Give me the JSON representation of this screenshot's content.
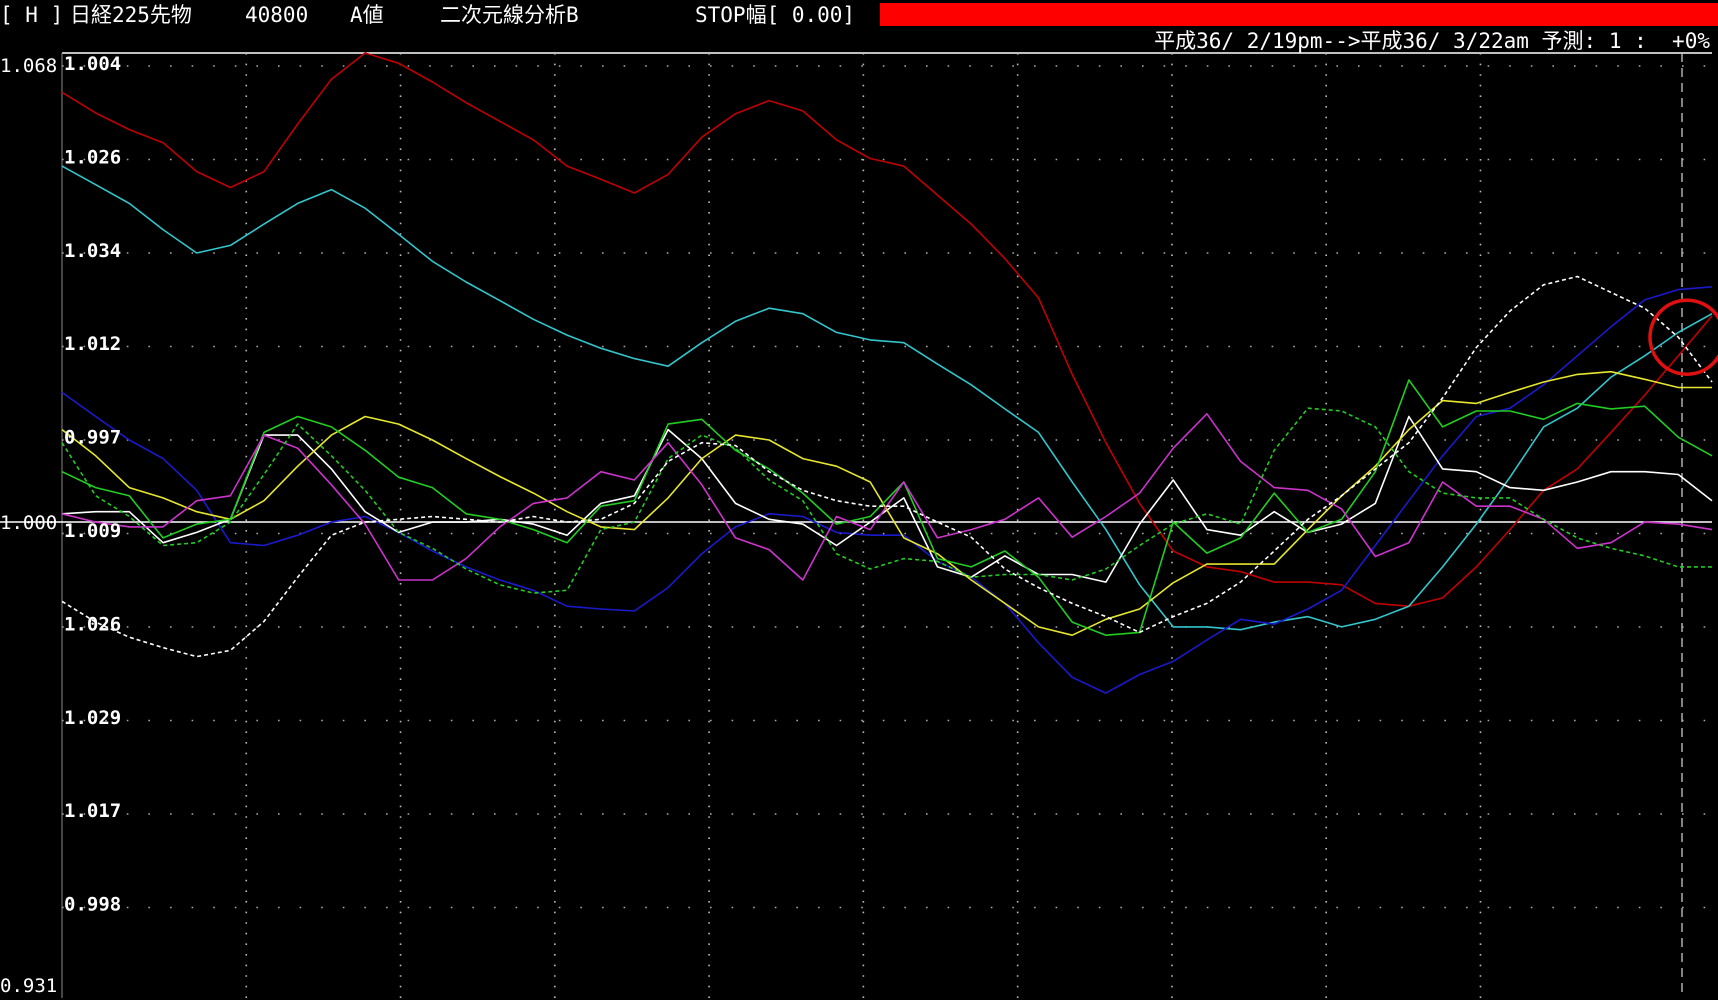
{
  "header": {
    "tag": "[ H ]",
    "instrument": "日経225先物",
    "code": "40800",
    "value_type": "A値",
    "analysis": "二次元線分析B",
    "stop": "STOP幅[ 0.00]",
    "range": "平成36/ 2/19pm-->平成36/ 3/22am 予測: 1 :  +0%"
  },
  "colors": {
    "background": "#000000",
    "red": "#c00000",
    "cyan": "#33c5cc",
    "blue": "#1a1acc",
    "white": "#ffffff",
    "yellow": "#e6e62e",
    "green": "#22cc22",
    "magenta": "#cc33cc",
    "green_dashed": "#22cc22",
    "white_dashed": "#ffffff",
    "highlight_circle": "#e01010"
  },
  "chart_data": {
    "type": "line",
    "title": "",
    "xlabel": "",
    "ylabel": "",
    "grid": true,
    "ylim": [
      0.931,
      1.068
    ],
    "left_axis": {
      "top": "1.068",
      "middle": "1.000",
      "bottom": "0.931"
    },
    "inner_ticks": [
      "1.004",
      "1.026",
      "1.034",
      "1.012",
      "0.997",
      "1.009",
      "1.026",
      "1.029",
      "1.017",
      "0.998"
    ],
    "x": [
      0,
      1,
      2,
      3,
      4,
      5,
      6,
      7,
      8,
      9,
      10,
      11,
      12,
      13,
      14,
      15,
      16,
      17,
      18,
      19,
      20,
      21,
      22,
      23,
      24,
      25,
      26,
      27,
      28,
      29,
      30,
      31,
      32,
      33,
      34,
      35,
      36,
      37,
      38,
      39,
      40,
      41,
      42,
      43,
      44,
      45,
      46,
      47,
      48,
      49
    ],
    "series": [
      {
        "color_key": "red",
        "dashed": false,
        "values": [
          1.0623,
          1.0593,
          1.0569,
          1.055,
          1.0508,
          1.0485,
          1.0508,
          1.0577,
          1.0642,
          1.068,
          1.0665,
          1.0638,
          1.0608,
          1.0581,
          1.0554,
          1.0516,
          1.0497,
          1.0477,
          1.0504,
          1.0558,
          1.0592,
          1.0611,
          1.0596,
          1.0554,
          1.0527,
          1.0516,
          1.0474,
          1.0432,
          1.0382,
          1.0325,
          1.0214,
          1.0115,
          1.0027,
          0.9958,
          0.9935,
          0.9928,
          0.9913,
          0.9913,
          0.9909,
          0.9882,
          0.9878,
          0.989,
          0.9935,
          0.9989,
          1.0046,
          1.0077,
          1.013,
          1.0184,
          1.0241,
          1.0299
        ]
      },
      {
        "color_key": "cyan",
        "dashed": false,
        "values": [
          1.0516,
          1.0489,
          1.0462,
          1.0424,
          1.039,
          1.0401,
          1.0432,
          1.0462,
          1.0482,
          1.0455,
          1.0417,
          1.0378,
          1.0348,
          1.0321,
          1.0294,
          1.0271,
          1.0252,
          1.0237,
          1.0226,
          1.026,
          1.0291,
          1.031,
          1.0302,
          1.0275,
          1.0264,
          1.026,
          1.0229,
          1.0199,
          1.0164,
          1.013,
          1.0058,
          0.9989,
          0.9909,
          0.9848,
          0.9848,
          0.9844,
          0.9855,
          0.9863,
          0.9848,
          0.9859,
          0.9878,
          0.9935,
          0.9997,
          1.0065,
          1.0138,
          1.0165,
          1.021,
          1.0241,
          1.0275,
          1.0302
        ]
      },
      {
        "color_key": "blue",
        "dashed": false,
        "values": [
          1.0188,
          1.0153,
          1.0119,
          1.0092,
          1.0046,
          0.997,
          0.9966,
          0.9981,
          1.0,
          1.0008,
          0.9985,
          0.9958,
          0.9935,
          0.9916,
          0.9901,
          0.9878,
          0.9874,
          0.9871,
          0.9905,
          0.9954,
          0.9993,
          1.0012,
          1.0008,
          0.9985,
          0.9981,
          0.9981,
          0.9943,
          0.992,
          0.9882,
          0.9825,
          0.9775,
          0.9752,
          0.9779,
          0.9798,
          0.9829,
          0.9859,
          0.9852,
          0.9874,
          0.9901,
          0.9966,
          1.0031,
          1.0096,
          1.0153,
          1.0165,
          1.0199,
          1.0241,
          1.0283,
          1.0322,
          1.0337,
          1.0341
        ]
      },
      {
        "color_key": "white",
        "dashed": false,
        "values": [
          1.0012,
          1.0015,
          1.0015,
          0.997,
          0.9985,
          1.0004,
          1.0126,
          1.0126,
          1.0077,
          1.0015,
          0.9985,
          1.0,
          1.0,
          1.0004,
          0.9997,
          0.9981,
          1.0027,
          1.0038,
          1.0134,
          1.0092,
          1.0027,
          1.0004,
          0.9997,
          0.9966,
          1.0,
          1.0035,
          0.9935,
          0.992,
          0.9951,
          0.9924,
          0.9924,
          0.9913,
          0.9997,
          1.0061,
          0.9989,
          0.9981,
          1.0015,
          0.9985,
          0.9997,
          1.0027,
          1.0153,
          1.0077,
          1.0073,
          1.005,
          1.0046,
          1.0058,
          1.0073,
          1.0073,
          1.0069,
          1.0031
        ]
      },
      {
        "color_key": "yellow",
        "dashed": false,
        "values": [
          1.0134,
          1.0096,
          1.005,
          1.0035,
          1.0015,
          1.0004,
          1.0031,
          1.0081,
          1.0126,
          1.0153,
          1.0142,
          1.0119,
          1.0092,
          1.0066,
          1.0042,
          1.0015,
          0.9993,
          0.9989,
          1.0035,
          1.0092,
          1.0126,
          1.0119,
          1.0092,
          1.0081,
          1.0058,
          0.9977,
          0.9954,
          0.9916,
          0.9882,
          0.9848,
          0.9836,
          0.9859,
          0.9874,
          0.9912,
          0.9939,
          0.9939,
          0.9939,
          0.9989,
          1.0038,
          1.0081,
          1.0134,
          1.0176,
          1.0172,
          1.0188,
          1.0203,
          1.0214,
          1.0218,
          1.0207,
          1.0195,
          1.0195
        ]
      },
      {
        "color_key": "green",
        "dashed": false,
        "values": [
          1.0073,
          1.005,
          1.0038,
          0.9977,
          0.9997,
          1.0004,
          1.013,
          1.0153,
          1.0138,
          1.0104,
          1.0065,
          1.005,
          1.0012,
          1.0004,
          0.9989,
          0.997,
          1.0023,
          1.0031,
          1.0142,
          1.0149,
          1.0104,
          1.0077,
          1.0042,
          0.9997,
          1.0008,
          1.0058,
          0.9947,
          0.9935,
          0.9958,
          0.992,
          0.9855,
          0.9836,
          0.984,
          1.0,
          0.9955,
          0.9977,
          1.0042,
          0.9985,
          1.0004,
          1.0073,
          1.0206,
          1.0138,
          1.0161,
          1.0161,
          1.0149,
          1.0172,
          1.0164,
          1.0168,
          1.0123,
          1.0096
        ]
      },
      {
        "color_key": "magenta",
        "dashed": false,
        "values": [
          1.0012,
          1.0,
          0.9993,
          0.9993,
          1.0031,
          1.0038,
          1.0126,
          1.0107,
          1.0054,
          0.9997,
          0.9916,
          0.9916,
          0.9947,
          0.9993,
          1.0027,
          1.0035,
          1.0073,
          1.0061,
          1.0115,
          1.0054,
          0.9977,
          0.996,
          0.9916,
          1.0008,
          0.9989,
          1.0058,
          0.9977,
          0.9989,
          1.0004,
          1.0035,
          0.9978,
          1.0008,
          1.0042,
          1.0107,
          1.0157,
          1.0088,
          1.005,
          1.0046,
          1.0019,
          0.995,
          0.997,
          1.0058,
          1.0023,
          1.0023,
          1.0004,
          0.9962,
          0.997,
          1.0,
          0.9997,
          0.9989
        ]
      },
      {
        "color_key": "green_dashed",
        "dashed": true,
        "values": [
          1.0115,
          1.0038,
          1.0008,
          0.9966,
          0.997,
          1.0,
          1.0069,
          1.0142,
          1.0096,
          1.0046,
          0.9985,
          0.9962,
          0.9932,
          0.9909,
          0.9897,
          0.9901,
          0.9989,
          1.0,
          1.0092,
          1.0126,
          1.0107,
          1.0061,
          1.0031,
          0.9954,
          0.9932,
          0.9947,
          0.9943,
          0.992,
          0.9924,
          0.9924,
          0.9916,
          0.9932,
          0.9966,
          0.9997,
          1.0012,
          0.9997,
          1.0104,
          1.0165,
          1.0161,
          1.0138,
          1.0073,
          1.0042,
          1.0035,
          1.0035,
          1.0004,
          0.9977,
          0.9962,
          0.9951,
          0.9935,
          0.9935
        ]
      },
      {
        "color_key": "white_dashed",
        "dashed": true,
        "values": [
          0.9885,
          0.9855,
          0.9833,
          0.9818,
          0.9805,
          0.9814,
          0.9856,
          0.992,
          0.9981,
          1.0,
          1.0004,
          1.0008,
          1.0004,
          1.0,
          1.0008,
          1.0,
          1.0004,
          1.0027,
          1.0088,
          1.0115,
          1.0111,
          1.0073,
          1.0046,
          1.0031,
          1.0023,
          1.0023,
          1.0,
          0.9978,
          0.9932,
          0.9905,
          0.9882,
          0.9863,
          0.984,
          0.9863,
          0.9882,
          0.9913,
          0.9958,
          1.0004,
          1.0038,
          1.0077,
          1.0115,
          1.018,
          1.0253,
          1.0306,
          1.0344,
          1.0356,
          1.0333,
          1.031,
          1.0268,
          1.0203
        ]
      }
    ],
    "annotations": [
      {
        "type": "circle",
        "index": 49,
        "value": 1.0268,
        "color_key": "highlight_circle"
      }
    ]
  }
}
